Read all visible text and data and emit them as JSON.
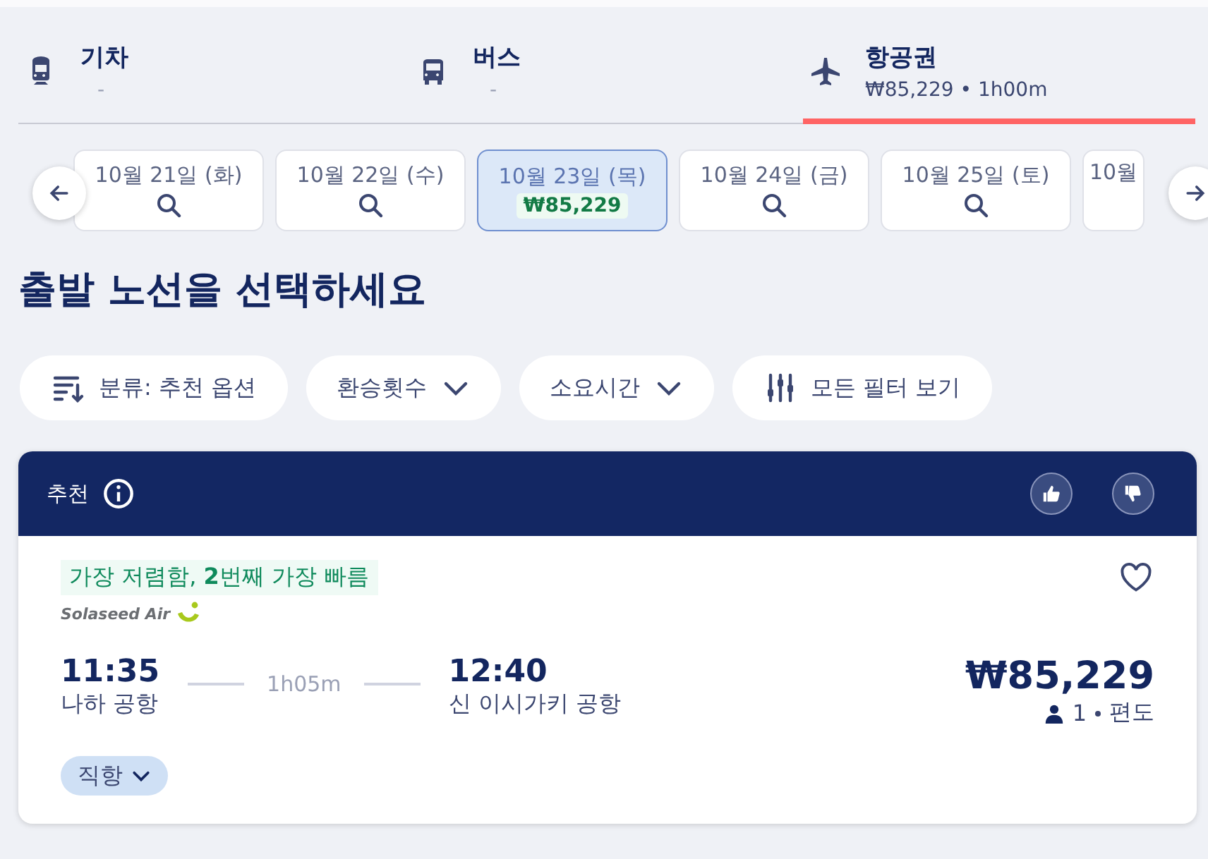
{
  "modes": [
    {
      "kind": "train",
      "label": "기차",
      "sub": "-",
      "selected": false
    },
    {
      "kind": "bus",
      "label": "버스",
      "sub": "-",
      "selected": false
    },
    {
      "kind": "plane",
      "label": "항공권",
      "sub": "₩85,229 • 1h00m",
      "selected": true
    }
  ],
  "dates": [
    {
      "label": "10월 21일 (화)",
      "selected": false
    },
    {
      "label": "10월 22일 (수)",
      "selected": false
    },
    {
      "label": "10월 23일 (목)",
      "price": "₩85,229",
      "selected": true
    },
    {
      "label": "10월 24일 (금)",
      "selected": false
    },
    {
      "label": "10월 25일 (토)",
      "selected": false
    },
    {
      "label": "10월",
      "selected": false
    }
  ],
  "heading": "출발 노선을 선택하세요",
  "filters": [
    {
      "kind": "sort",
      "label": "분류: 추천 옵션"
    },
    {
      "kind": "dropdown",
      "label": "환승횟수"
    },
    {
      "kind": "dropdown",
      "label": "소요시간"
    },
    {
      "kind": "all",
      "label": "모든 필터 보기"
    }
  ],
  "result": {
    "header": "추천",
    "tag": "가장 저렴함, **2**번째 가장 빠름",
    "airline": "Solaseed Air",
    "depart_time": "11:35",
    "depart_airport": "나하 공항",
    "duration": "1h05m",
    "arrive_time": "12:40",
    "arrive_airport": "신 이시가키 공항",
    "price": "₩85,229",
    "passengers": "1",
    "trip": "편도",
    "stops": "직항",
    "favorite": false
  }
}
